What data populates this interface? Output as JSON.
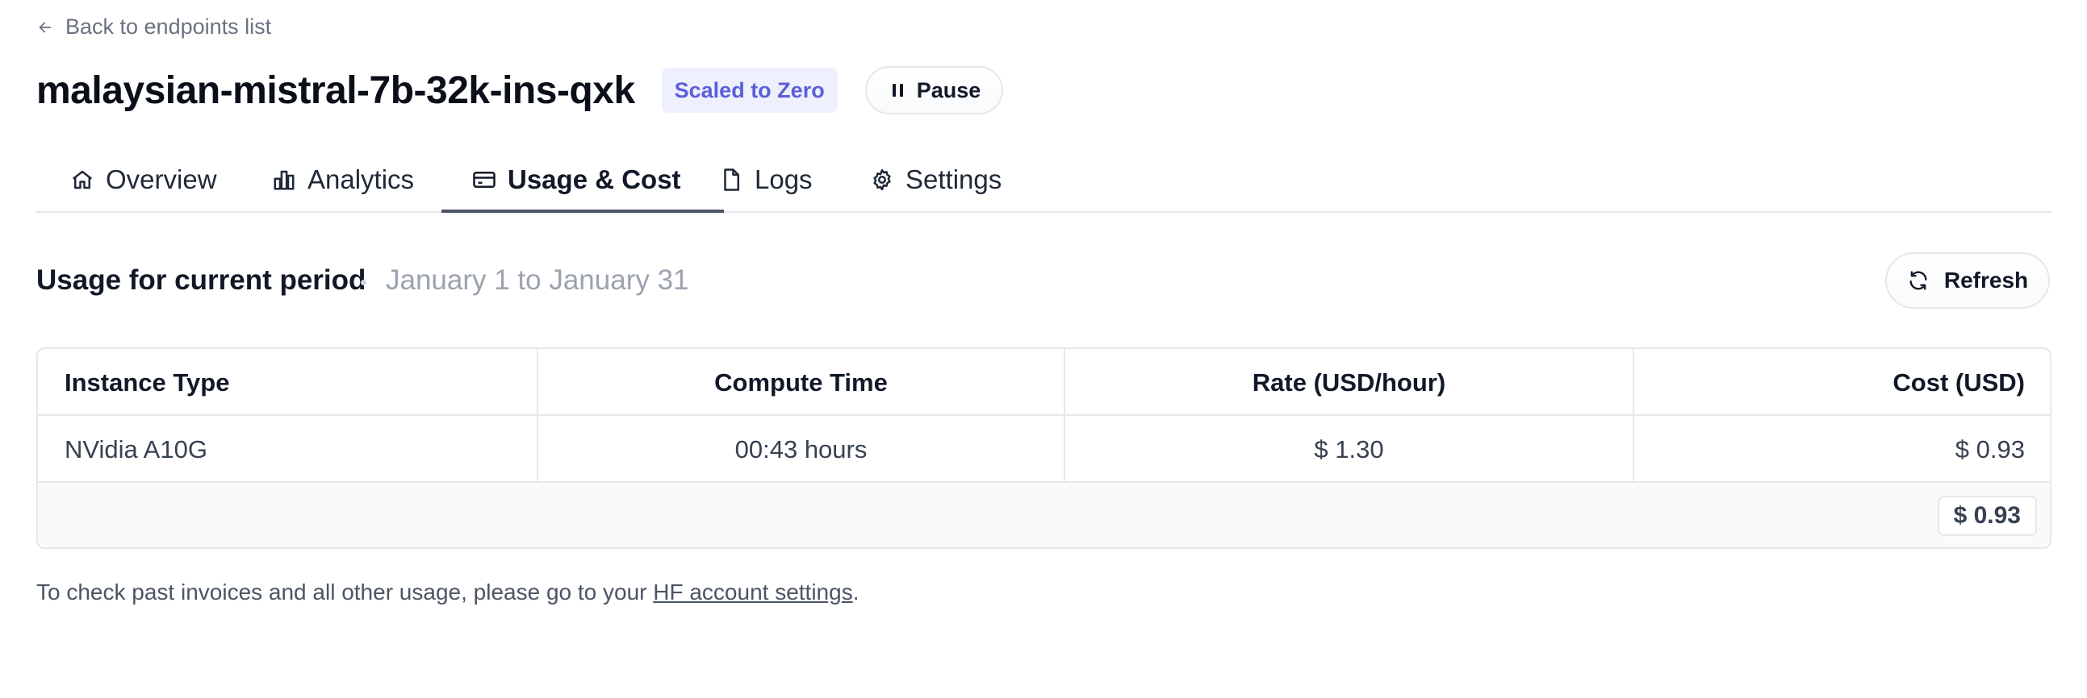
{
  "back_link": {
    "label": "Back to endpoints list",
    "icon": "arrow-left-icon"
  },
  "header": {
    "title": "malaysian-mistral-7b-32k-ins-qxk",
    "status_badge": "Scaled to Zero",
    "pause_button": "Pause"
  },
  "tabs": [
    {
      "label": "Overview",
      "icon": "home-icon",
      "active": false
    },
    {
      "label": "Analytics",
      "icon": "bar-chart-icon",
      "active": false
    },
    {
      "label": "Usage & Cost",
      "icon": "credit-card-icon",
      "active": true
    },
    {
      "label": "Logs",
      "icon": "document-icon",
      "active": false
    },
    {
      "label": "Settings",
      "icon": "gear-icon",
      "active": false
    }
  ],
  "usage": {
    "title": "Usage for current period",
    "period": "January 1 to January 31",
    "refresh_button": "Refresh"
  },
  "table": {
    "columns": [
      "Instance Type",
      "Compute Time",
      "Rate (USD/hour)",
      "Cost (USD)"
    ],
    "rows": [
      [
        "NVidia A10G",
        "00:43 hours",
        "$ 1.30",
        "$ 0.93"
      ]
    ],
    "total": "$ 0.93"
  },
  "footer": {
    "text_before": "To check past invoices and all other usage, please go to your ",
    "link_text": "HF account settings",
    "text_after": "."
  },
  "colors": {
    "badge_bg": "#eef0fe",
    "badge_text": "#5b5fd6",
    "active_tab_underline": "#4b5563",
    "muted_text": "#9ca3af",
    "border": "#e5e7eb"
  }
}
